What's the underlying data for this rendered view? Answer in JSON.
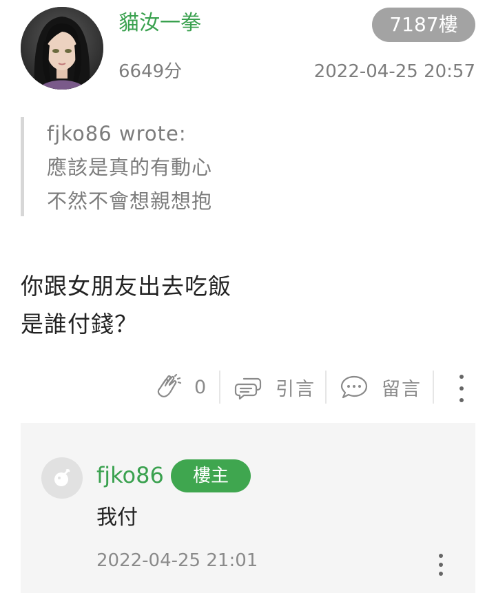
{
  "post": {
    "username": "貓汝一拳",
    "floor": "7187樓",
    "score": "6649分",
    "time": "2022-04-25 20:57",
    "quote": {
      "header": "fjko86 wrote:",
      "lines": [
        "應該是真的有動心",
        "不然不會想親想抱"
      ]
    },
    "content_lines": [
      "你跟女朋友出去吃飯",
      "是誰付錢？"
    ],
    "actions": {
      "like_count": "0",
      "quote_label": "引言",
      "comment_label": "留言"
    }
  },
  "reply": {
    "username": "fjko86",
    "badge": "樓主",
    "text": "我付",
    "time": "2022-04-25 21:01"
  },
  "icons": {
    "like": "clap-hands-icon",
    "quote": "quote-bubble-icon",
    "comment": "comment-bubble-icon",
    "more": "more-vertical-icon"
  },
  "colors": {
    "accent_green": "#3aa14f",
    "floor_badge_bg": "#a3a3a3",
    "reply_bg": "#f5f5f5"
  }
}
